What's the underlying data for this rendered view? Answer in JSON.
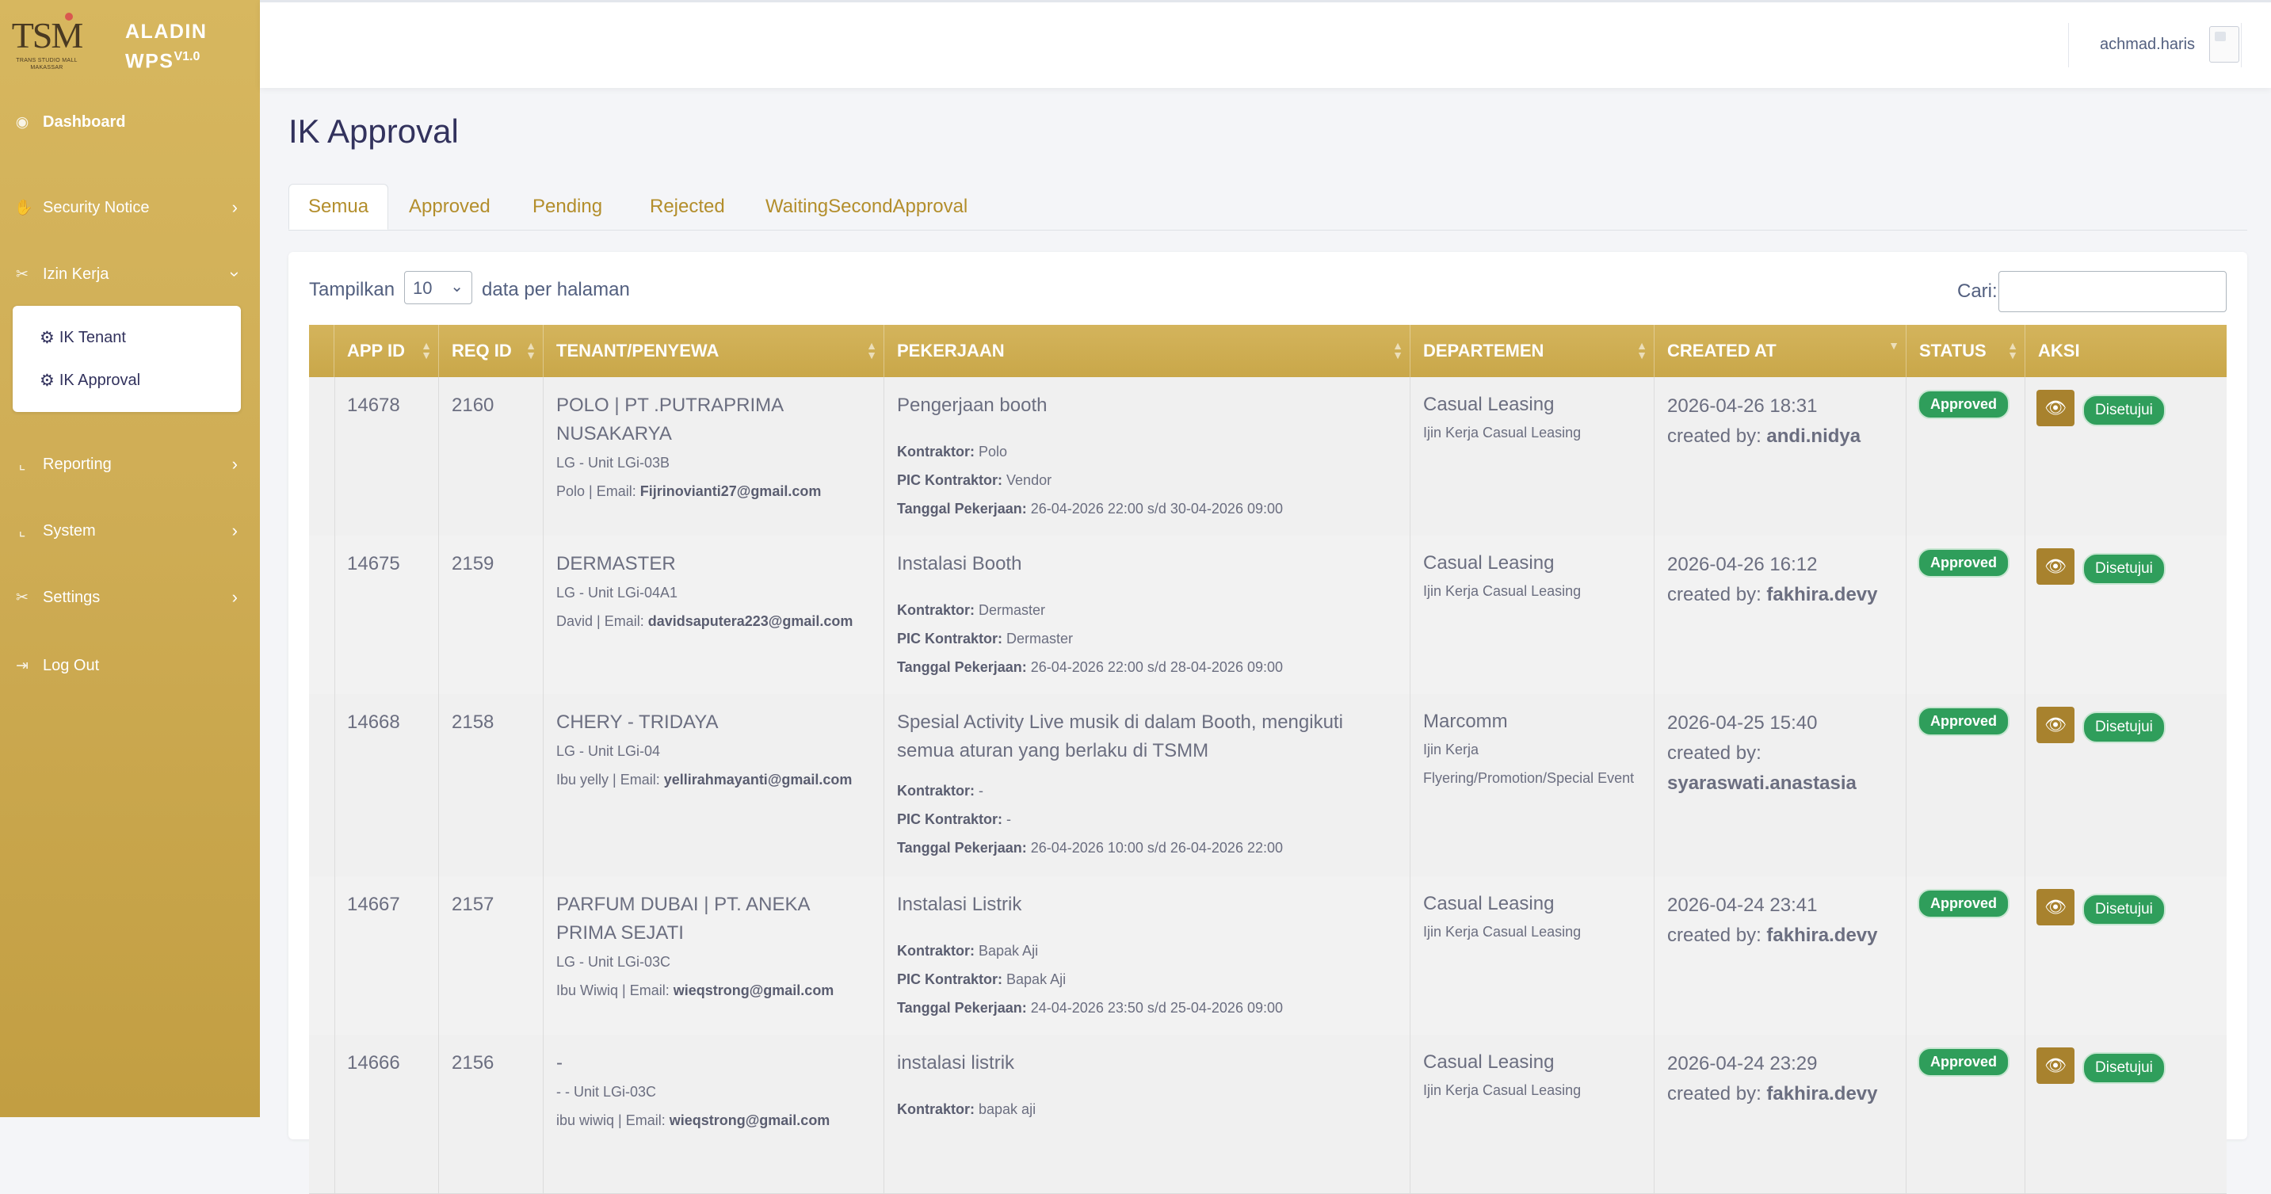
{
  "brand": {
    "name_line1": "ALADIN",
    "name_line2": "WPS",
    "version": "V1.0",
    "logo_text": "TSM",
    "logo_sub": "TRANS STUDIO MALL MAKASSAR"
  },
  "sidebar": {
    "items": [
      {
        "label": "Dashboard",
        "icon": "palette-icon"
      },
      {
        "label": "Security Notice",
        "icon": "hand-icon"
      },
      {
        "label": "Izin Kerja",
        "icon": "tools-icon"
      },
      {
        "label": "Reporting",
        "icon": "chart-icon"
      },
      {
        "label": "System",
        "icon": "chart-icon"
      },
      {
        "label": "Settings",
        "icon": "tools-icon"
      },
      {
        "label": "Log Out",
        "icon": "logout-icon"
      }
    ],
    "submenu": [
      {
        "label": "IK Tenant"
      },
      {
        "label": "IK Approval"
      }
    ]
  },
  "topbar": {
    "username": "achmad.haris"
  },
  "page": {
    "title": "IK Approval"
  },
  "tabs": [
    {
      "label": "Semua"
    },
    {
      "label": "Approved"
    },
    {
      "label": "Pending"
    },
    {
      "label": "Rejected"
    },
    {
      "label": "WaitingSecondApproval"
    }
  ],
  "table_controls": {
    "show_prefix": "Tampilkan",
    "page_size": "10",
    "show_suffix": "data per halaman",
    "search_label": "Cari:"
  },
  "table": {
    "headers": [
      "APP ID",
      "REQ ID",
      "TENANT/PENYEWA",
      "PEKERJAAN",
      "DEPARTEMEN",
      "CREATED AT",
      "STATUS",
      "AKSI"
    ],
    "labels": {
      "kontraktor": "Kontraktor:",
      "pic": "PIC Kontraktor:",
      "tanggal": "Tanggal Pekerjaan:",
      "created_by": "created by:",
      "approve_btn": "Disetujui"
    },
    "rows": [
      {
        "app_id": "14678",
        "req_id": "2160",
        "tenant": "POLO | PT .PUTRAPRIMA NUSAKARYA",
        "unit": "LG - Unit LGi-03B",
        "contact": "Polo | Email:",
        "email": "Fijrinovianti27@gmail.com",
        "job": "Pengerjaan booth",
        "kontraktor": "Polo",
        "pic": "Vendor",
        "tanggal": "26-04-2026 22:00 s/d 30-04-2026 09:00",
        "dept": "Casual Leasing",
        "dept_sub": "Ijin Kerja Casual Leasing",
        "created_at": "2026-04-26 18:31",
        "created_by": "andi.nidya",
        "status": "Approved"
      },
      {
        "app_id": "14675",
        "req_id": "2159",
        "tenant": "DERMASTER",
        "unit": "LG - Unit LGi-04A1",
        "contact": "David | Email:",
        "email": "davidsaputera223@gmail.com",
        "job": "Instalasi Booth",
        "kontraktor": "Dermaster",
        "pic": "Dermaster",
        "tanggal": "26-04-2026 22:00 s/d 28-04-2026 09:00",
        "dept": "Casual Leasing",
        "dept_sub": "Ijin Kerja Casual Leasing",
        "created_at": "2026-04-26 16:12",
        "created_by": "fakhira.devy",
        "status": "Approved"
      },
      {
        "app_id": "14668",
        "req_id": "2158",
        "tenant": "CHERY - TRIDAYA",
        "unit": "LG - Unit LGi-04",
        "contact": "Ibu yelly | Email:",
        "email": "yellirahmayanti@gmail.com",
        "job": "Spesial Activity Live musik di dalam Booth, mengikuti semua aturan yang berlaku di TSMM",
        "kontraktor": "-",
        "pic": "-",
        "tanggal": "26-04-2026 10:00 s/d 26-04-2026 22:00",
        "dept": "Marcomm",
        "dept_sub": "Ijin Kerja Flyering/Promotion/Special Event",
        "created_at": "2026-04-25 15:40",
        "created_by": "syaraswati.anastasia",
        "status": "Approved"
      },
      {
        "app_id": "14667",
        "req_id": "2157",
        "tenant": "PARFUM DUBAI | PT. ANEKA PRIMA SEJATI",
        "unit": "LG - Unit LGi-03C",
        "contact": "Ibu Wiwiq | Email:",
        "email": "wieqstrong@gmail.com",
        "job": "Instalasi Listrik",
        "kontraktor": "Bapak Aji",
        "pic": "Bapak Aji",
        "tanggal": "24-04-2026 23:50 s/d 25-04-2026 09:00",
        "dept": "Casual Leasing",
        "dept_sub": "Ijin Kerja Casual Leasing",
        "created_at": "2026-04-24 23:41",
        "created_by": "fakhira.devy",
        "status": "Approved"
      },
      {
        "app_id": "14666",
        "req_id": "2156",
        "tenant": "-",
        "unit": "- - Unit LGi-03C",
        "contact": "ibu wiwiq | Email:",
        "email": "wieqstrong@gmail.com",
        "job": "instalasi listrik",
        "kontraktor": "bapak aji",
        "pic": "",
        "tanggal": "",
        "dept": "Casual Leasing",
        "dept_sub": "Ijin Kerja Casual Leasing",
        "created_at": "2026-04-24 23:29",
        "created_by": "fakhira.devy",
        "status": "Approved"
      }
    ]
  }
}
